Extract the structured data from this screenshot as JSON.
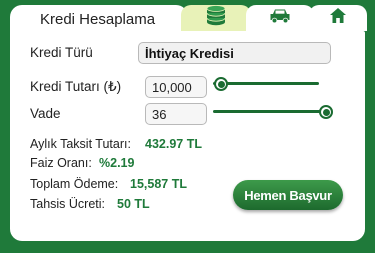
{
  "tabs": {
    "title": "Kredi Hesaplama",
    "icons": [
      "coins-icon",
      "car-icon",
      "home-icon"
    ]
  },
  "form": {
    "loan_type_label": "Kredi Türü",
    "loan_type_value": "İhtiyaç Kredisi",
    "amount_label": "Kredi Tutarı (₺)",
    "amount_value": "10,000",
    "term_label": "Vade",
    "term_value": "36",
    "amount_slider_fraction": 0.08,
    "term_slider_fraction": 1.0
  },
  "summary": {
    "installment_label": "Aylık Taksit Tutarı:",
    "installment_value": "432.97 TL",
    "rate_label": "Faiz Oranı:",
    "rate_value": "%2.19",
    "total_label": "Toplam Ödeme:",
    "total_value": "15,587 TL",
    "fee_label": "Tahsis Ücreti:",
    "fee_value": "50 TL"
  },
  "actions": {
    "apply_label": "Hemen Başvur"
  },
  "colors": {
    "brand_green": "#1f7a3a",
    "active_tab": "#e8f2b8"
  }
}
